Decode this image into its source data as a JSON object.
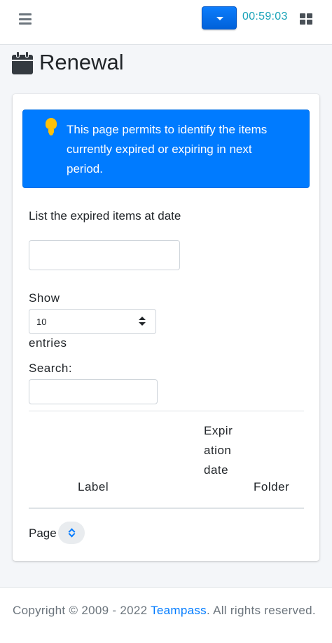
{
  "navbar": {
    "menu_icon": "hamburger-icon",
    "timer": "00:59:03",
    "apps_icon": "grid-icon"
  },
  "page": {
    "title": "Renewal",
    "title_icon": "calendar-icon"
  },
  "callout": {
    "icon": "lightbulb-icon",
    "text": "This page permits to identify the items currently expired or expiring in next period."
  },
  "form": {
    "date_label": "List the expired items at date",
    "date_value": "",
    "show_label": "Show",
    "entries_value": "10",
    "entries_label": "entries",
    "search_label": "Search:",
    "search_value": ""
  },
  "table": {
    "columns": [
      "Label",
      "Expiration date",
      "Folder"
    ],
    "rows": []
  },
  "pagination": {
    "page_label": "Page"
  },
  "footer": {
    "prefix": "Copyright © 2009 - 2022 ",
    "link_text": "Teampass",
    "suffix": ". All rights reserved."
  },
  "colors": {
    "primary": "#007bff",
    "timer": "#17a2b8",
    "bulb": "#ffc107",
    "background": "#f4f6f9"
  }
}
